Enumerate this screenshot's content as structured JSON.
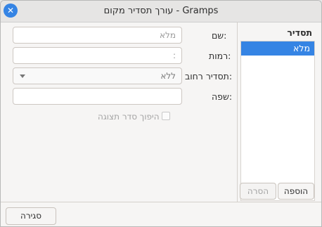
{
  "window": {
    "title": "עורך תסדיר מקום - Gramps"
  },
  "form": {
    "name_label": "שם:",
    "name_placeholder": "מלא",
    "levels_label": "רמות:",
    "levels_placeholder": ":",
    "street_label": "תסדיר רחוב:",
    "street_value": "ללא",
    "language_label": "שפה:",
    "language_value": "",
    "reverse_label": "היפוך סדר תצוגה"
  },
  "side": {
    "header": "תסדיר",
    "items": [
      "מלא"
    ],
    "add_label": "הוספה",
    "remove_label": "הסרה"
  },
  "footer": {
    "close_label": "סגירה"
  }
}
